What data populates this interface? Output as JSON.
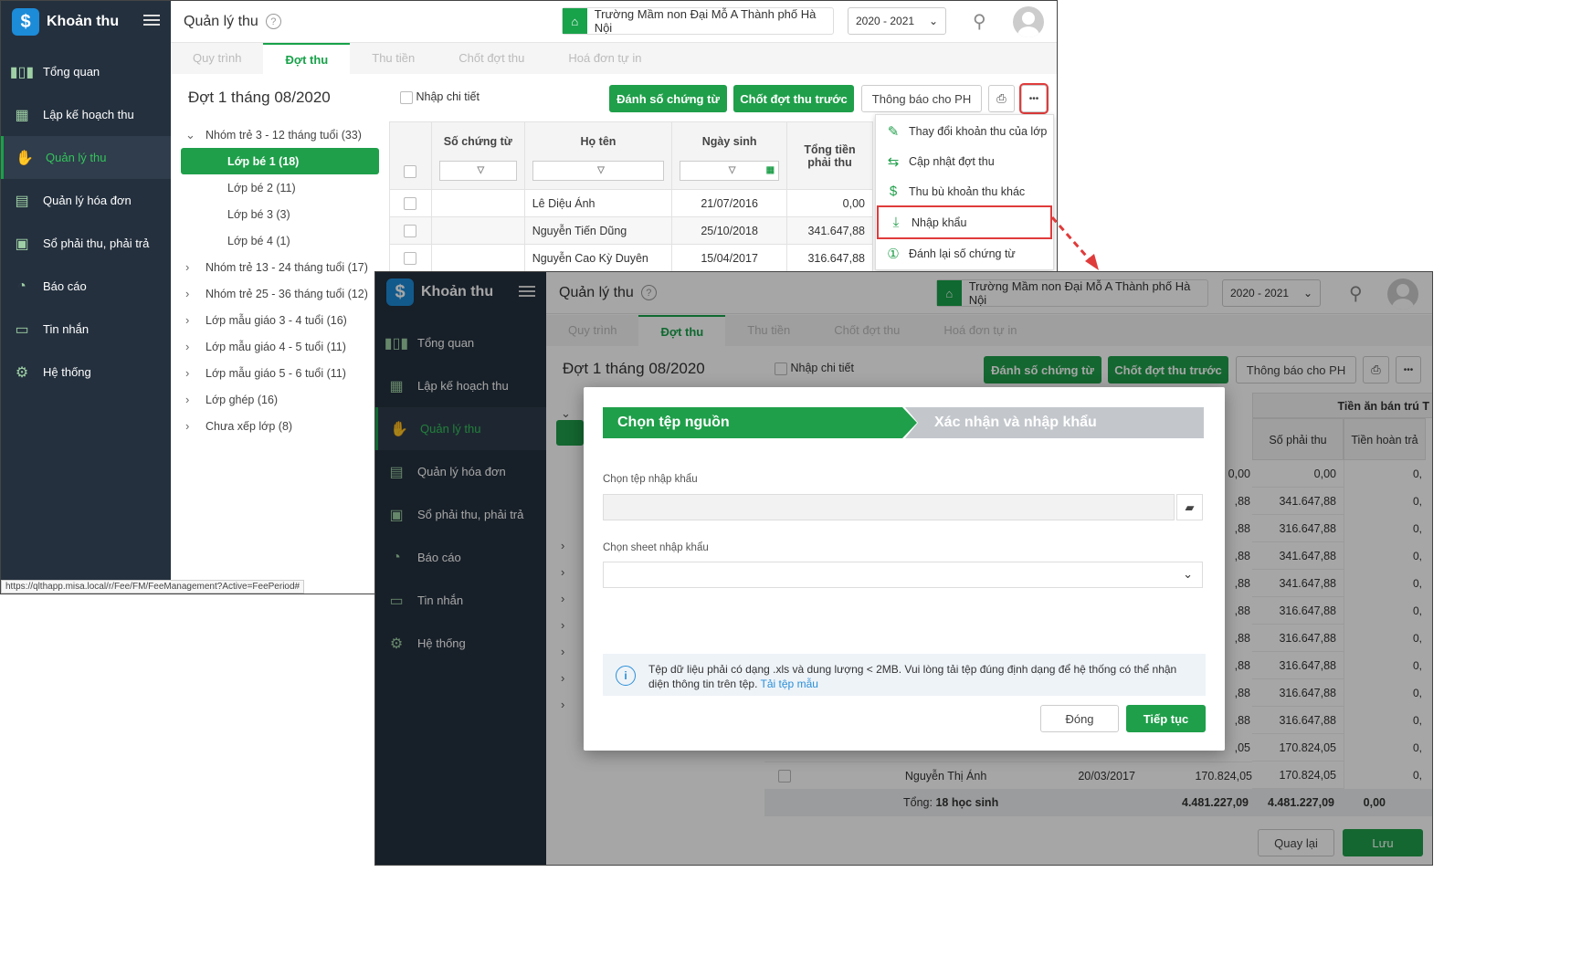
{
  "app": {
    "name": "Khoản thu",
    "logo_glyph": "$"
  },
  "sidebar": {
    "items": [
      {
        "label": "Tổng quan",
        "icon": "bar-chart-icon"
      },
      {
        "label": "Lập kế hoạch thu",
        "icon": "calendar-money-icon"
      },
      {
        "label": "Quản lý thu",
        "icon": "hand-coin-icon",
        "active": true
      },
      {
        "label": "Quản lý hóa đơn",
        "icon": "invoice-icon"
      },
      {
        "label": "Sổ phải thu, phải trả",
        "icon": "ledger-icon"
      },
      {
        "label": "Báo cáo",
        "icon": "pie-chart-icon"
      },
      {
        "label": "Tin nhắn",
        "icon": "message-icon"
      },
      {
        "label": "Hệ thống",
        "icon": "gear-icon"
      }
    ]
  },
  "header": {
    "title": "Quản lý thu",
    "help": "?",
    "school": "Trường Mầm non Đại Mỗ A Thành phố Hà Nội",
    "year": "2020 - 2021"
  },
  "tabs": [
    "Quy trình",
    "Đợt thu",
    "Thu tiền",
    "Chốt đợt thu",
    "Hoá đơn tự in"
  ],
  "period_title": "Đợt 1 tháng 08/2020",
  "detail_checkbox": "Nhập chi tiết",
  "toolbar": {
    "number_docs": "Đánh số chứng từ",
    "close_prev": "Chốt đợt thu trước",
    "notify": "Thông báo cho PH",
    "more": "•••"
  },
  "tree": [
    {
      "label": "Nhóm trẻ 3 - 12 tháng tuổi (33)",
      "arrow": "⌄"
    },
    {
      "label": "Lớp bé 1 (18)",
      "selected": true
    },
    {
      "label": "Lớp bé 2 (11)"
    },
    {
      "label": "Lớp bé 3 (3)"
    },
    {
      "label": "Lớp bé 4 (1)"
    },
    {
      "label": "Nhóm trẻ 13 - 24 tháng tuổi (17)",
      "arrow": "›"
    },
    {
      "label": "Nhóm trẻ 25 - 36 tháng tuổi (12)",
      "arrow": "›"
    },
    {
      "label": "Lớp mẫu giáo 3 - 4 tuổi (16)",
      "arrow": "›"
    },
    {
      "label": "Lớp mẫu giáo 4 - 5 tuổi (11)",
      "arrow": "›"
    },
    {
      "label": "Lớp mẫu giáo 5 - 6 tuổi (11)",
      "arrow": "›"
    },
    {
      "label": "Lớp ghép (16)",
      "arrow": "›"
    },
    {
      "label": "Chưa xếp lớp (8)",
      "arrow": "›"
    }
  ],
  "table": {
    "headers": [
      "Số chứng từ",
      "Họ tên",
      "Ngày sinh",
      "Tổng tiền phải thu"
    ],
    "rows": [
      {
        "name": "Lê Diệu Ánh",
        "dob": "21/07/2016",
        "total": "0,00"
      },
      {
        "name": "Nguyễn Tiến Dũng",
        "dob": "25/10/2018",
        "total": "341.647,88"
      },
      {
        "name": "Nguyễn Cao Kỳ Duyên",
        "dob": "15/04/2017",
        "total": "316.647,88"
      }
    ]
  },
  "menu": [
    {
      "label": "Thay đổi khoản thu của lớp",
      "icon": "edit-icon"
    },
    {
      "label": "Cập nhật đợt thu",
      "icon": "refresh-icon"
    },
    {
      "label": "Thu bù khoản thu khác",
      "icon": "money-bag-icon"
    },
    {
      "label": "Nhập khẩu",
      "icon": "import-icon",
      "highlight": true
    },
    {
      "label": "Đánh lại số chứng từ",
      "icon": "renumber-icon"
    }
  ],
  "status_url": "https://qlthapp.misa.local/r/Fee/FM/FeeManagement?Active=FeePeriod#",
  "back_window": {
    "right_col_header": "Tiền ăn bán trú T",
    "sub_headers": [
      "Số phải thu",
      "Tiền hoàn trả"
    ],
    "values": [
      "0,00",
      "341.647,88",
      "316.647,88",
      "341.647,88",
      "341.647,88",
      "316.647,88",
      "316.647,88",
      "316.647,88",
      "316.647,88",
      "316.647,88",
      "170.824,05",
      "170.824,05"
    ],
    "left_values": [
      "0,00",
      ",88",
      ",88",
      ",88",
      ",88",
      ",88",
      ",88",
      ",88",
      ",88",
      ",88",
      ",05"
    ],
    "last_row": {
      "name": "Nguyễn Thị Ánh",
      "dob": "20/03/2017",
      "total": "170.824,05"
    },
    "footer": {
      "label": "Tổng: ",
      "count": "18 học sinh",
      "total": "4.481.227,09",
      "total2": "4.481.227,09",
      "last": "0,00"
    },
    "back_btn": "Quay lại",
    "save_btn": "Lưu"
  },
  "dialog": {
    "step1": "Chọn tệp nguồn",
    "step2": "Xác nhận và nhập khẩu",
    "file_label": "Chọn tệp nhập khẩu",
    "sheet_label": "Chọn sheet nhập khẩu",
    "note_text": "Tệp dữ liệu phải có dạng .xls và dung lượng < 2MB. Vui lòng tải tệp đúng định dạng để hệ thống có thể nhận diện thông tin trên tệp.",
    "note_link": "Tải tệp mẫu",
    "close": "Đóng",
    "continue": "Tiếp tục"
  },
  "colors": {
    "accent": "#1f9f4a",
    "sidebar": "#24303e",
    "highlight": "#e03b3b",
    "link": "#2a8fd8"
  }
}
